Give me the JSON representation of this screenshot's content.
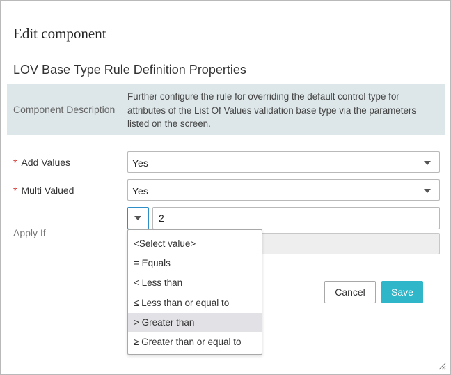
{
  "dialog": {
    "title": "Edit component",
    "section_title": "LOV Base Type Rule Definition Properties"
  },
  "description": {
    "label": "Component Description",
    "text": "Further configure the rule for overriding the default control type for attributes of the List Of Values validation base type via the parameters listed on the screen."
  },
  "fields": {
    "add_values": {
      "required_mark": "*",
      "label": "Add Values",
      "value": "Yes"
    },
    "multi_valued": {
      "required_mark": "*",
      "label": "Multi Valued",
      "value": "Yes"
    },
    "apply_if": {
      "label": "Apply If",
      "value": "2"
    }
  },
  "dropdown": {
    "options": [
      "<Select value>",
      "= Equals",
      "< Less than",
      "≤ Less than or equal to",
      "> Greater than",
      "≥ Greater than or equal to"
    ],
    "highlighted_index": 4
  },
  "buttons": {
    "cancel": "Cancel",
    "save": "Save"
  },
  "colors": {
    "accent": "#2fb6c8",
    "panel": "#dde6e8",
    "required": "#c9302c"
  }
}
